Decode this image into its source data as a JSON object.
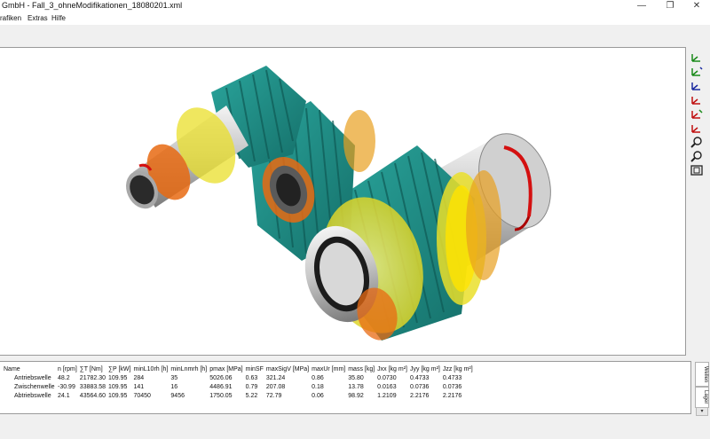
{
  "window": {
    "title": "GmbH - Fall_3_ohneModifikationen_18080201.xml",
    "minimize_glyph": "—",
    "restore_glyph": "❐",
    "close_glyph": "✕"
  },
  "menu": {
    "items": [
      "rafiken",
      "Extras",
      "Hilfe"
    ]
  },
  "toolbar": {
    "icons": [
      "axis-view-icon",
      "axis-view-icon",
      "axis-view-icon",
      "axis-view-red-icon",
      "axis-view-red-icon",
      "axis-view-red-icon",
      "zoom-icon",
      "zoom-icon",
      "zoom-fit-icon"
    ]
  },
  "table": {
    "headers": [
      "Name",
      "n [rpm]",
      "∑T [Nm]",
      "∑P [kW]",
      "minL10rh [h]",
      "minLnmrh [h]",
      "pmax [MPa]",
      "minSF",
      "maxSigV [MPa]",
      "maxUr [mm]",
      "mass [kg]",
      "Jxx [kg m²]",
      "Jyy [kg m²]",
      "Jzz [kg m²]"
    ],
    "rows": [
      [
        "Antriebswelle",
        "48.2",
        "21782.30",
        "109.95",
        "284",
        "35",
        "5026.06",
        "0.63",
        "321.24",
        "0.86",
        "35.80",
        "0.0730",
        "0.4733",
        "0.4733"
      ],
      [
        "Zwischenwelle",
        "-30.99",
        "33883.58",
        "109.95",
        "141",
        "16",
        "4486.91",
        "0.79",
        "207.08",
        "0.18",
        "13.78",
        "0.0163",
        "0.0736",
        "0.0736"
      ],
      [
        "Abtriebswelle",
        "24.1",
        "43564.60",
        "109.95",
        "70450",
        "9456",
        "1750.05",
        "5.22",
        "72.79",
        "0.06",
        "98.92",
        "1.2109",
        "2.2176",
        "2.2176"
      ]
    ]
  },
  "sidetabs": {
    "wellen": "Wellen",
    "lager": "Lager"
  }
}
